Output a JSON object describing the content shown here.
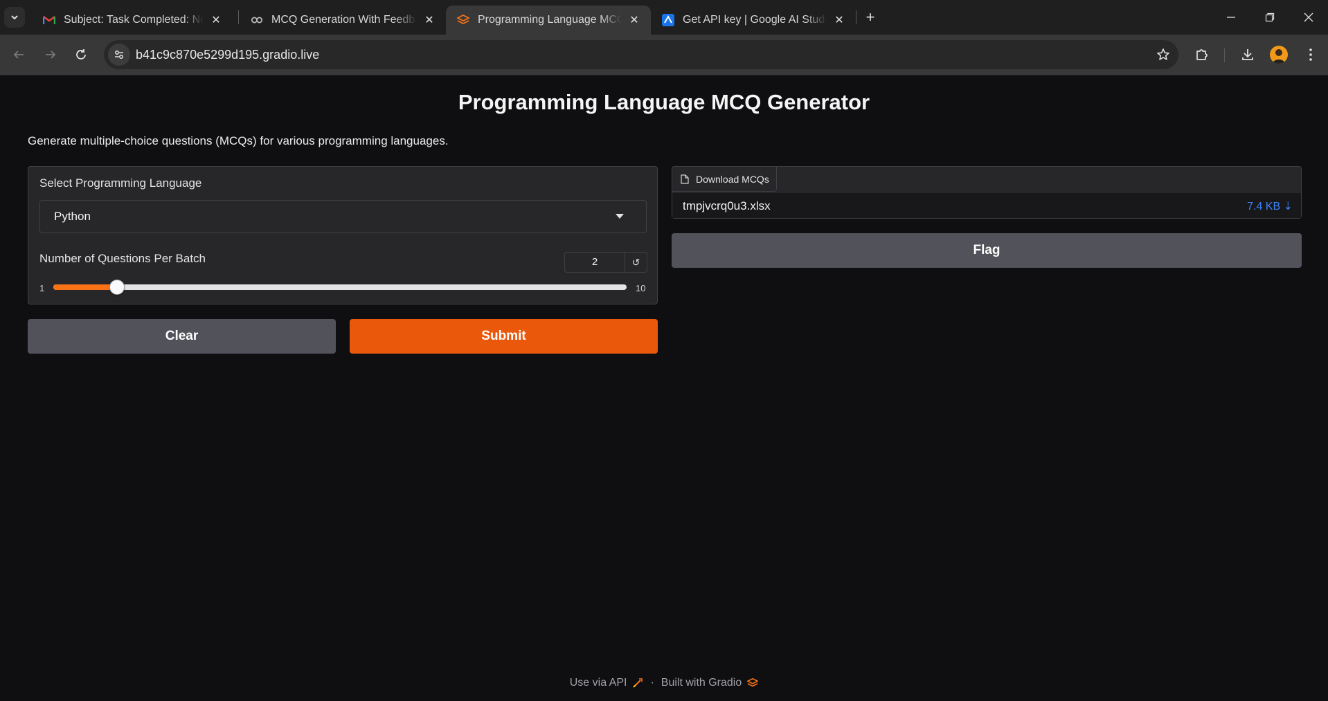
{
  "browser": {
    "tabs": [
      {
        "title": "Subject: Task Completed: New L",
        "favicon": "gmail-icon",
        "active": false
      },
      {
        "title": "MCQ Generation With Feedback",
        "favicon": "colab-icon",
        "active": false
      },
      {
        "title": "Programming Language MCQ Generator",
        "favicon": "gradio-icon",
        "active": true
      },
      {
        "title": "Get API key | Google AI Studio",
        "favicon": "ai-studio-icon",
        "active": false
      }
    ],
    "url": "b41c9c870e5299d195.gradio.live"
  },
  "app": {
    "title": "Programming Language MCQ Generator",
    "description": "Generate multiple-choice questions (MCQs) for various programming languages.",
    "language": {
      "label": "Select Programming Language",
      "value": "Python"
    },
    "questions": {
      "label": "Number of Questions Per Batch",
      "value": "2",
      "min": "1",
      "max": "10",
      "fraction": 0.111
    },
    "buttons": {
      "clear": "Clear",
      "submit": "Submit",
      "flag": "Flag"
    },
    "download": {
      "label": "Download MCQs",
      "file_name": "tmpjvcrq0u3.xlsx",
      "file_size": "7.4 KB ⇣"
    },
    "footer": {
      "api": "Use via API",
      "separator": "·",
      "built": "Built with Gradio"
    },
    "colors": {
      "accent": "#ea580c",
      "slider": "#f97316",
      "link": "#3b82f6"
    }
  }
}
